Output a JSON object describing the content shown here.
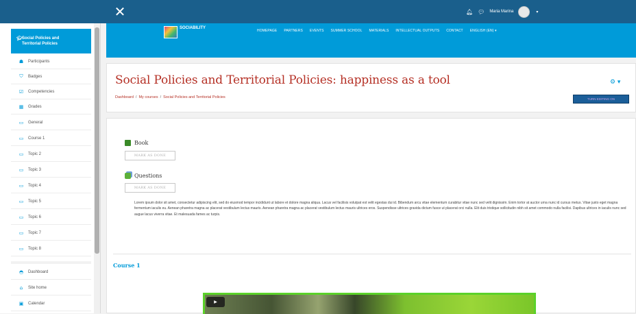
{
  "topbar": {
    "close_glyph": "✕",
    "user_name": "Maria Marina",
    "caret": "▾",
    "bell_icon": "bell-icon",
    "chat_icon": "chat-icon"
  },
  "sidebar": {
    "course_title_line1": "Social Policies and",
    "course_title_line2": "Territorial Policies",
    "items": [
      {
        "label": "Participants",
        "icon": "users-icon",
        "glyph": "☗"
      },
      {
        "label": "Badges",
        "icon": "shield-icon",
        "glyph": "⛉"
      },
      {
        "label": "Competencies",
        "icon": "check-icon",
        "glyph": "☑"
      },
      {
        "label": "Grades",
        "icon": "table-icon",
        "glyph": "▦"
      },
      {
        "label": "General",
        "icon": "folder-icon",
        "glyph": "▭"
      },
      {
        "label": "Course 1",
        "icon": "folder-icon",
        "glyph": "▭"
      },
      {
        "label": "Topic 2",
        "icon": "folder-icon",
        "glyph": "▭"
      },
      {
        "label": "Topic 3",
        "icon": "folder-icon",
        "glyph": "▭"
      },
      {
        "label": "Topic 4",
        "icon": "folder-icon",
        "glyph": "▭"
      },
      {
        "label": "Topic 5",
        "icon": "folder-icon",
        "glyph": "▭"
      },
      {
        "label": "Topic 6",
        "icon": "folder-icon",
        "glyph": "▭"
      },
      {
        "label": "Topic 7",
        "icon": "folder-icon",
        "glyph": "▭"
      },
      {
        "label": "Topic 8",
        "icon": "folder-icon",
        "glyph": "▭"
      },
      {
        "label": "Dashboard",
        "icon": "dashboard-icon",
        "glyph": "◓"
      },
      {
        "label": "Site home",
        "icon": "home-icon",
        "glyph": "⌂"
      },
      {
        "label": "Calendar",
        "icon": "calendar-icon",
        "glyph": "▣"
      }
    ]
  },
  "header": {
    "logo_name": "SOCIABILITY",
    "menu": [
      "HOMEPAGE",
      "PARTNERS",
      "EVENTS",
      "SUMMER SCHOOL",
      "MATERIALS",
      "INTELLECTUAL OUTPUTS",
      "CONTACT",
      "ENGLISH (EN) ▾"
    ]
  },
  "page": {
    "title": "Social Policies and Territorial Policies: happiness as a tool",
    "breadcrumb": [
      "Dashboard",
      "My courses",
      "Social Policies and Territorial Policies"
    ],
    "breadcrumb_sep": "/",
    "gear_glyph": "⚙ ▾",
    "edit_button": "TURN EDITING ON"
  },
  "content": {
    "activities": [
      {
        "name": "Book",
        "button": "MARK AS DONE"
      },
      {
        "name": "Questions",
        "button": "MARK AS DONE"
      }
    ],
    "summary": "Lorem ipsum dolor sit amet, consectetur adipiscing elit, sed do eiusmod tempor incididunt ut labore et dolore magna aliqua. Lacus vel facilisis volutpat est velit egestas dui id. Bibendum arcu vitae elementum curabitur vitae nunc sed velit dignissim. Enim tortor at auctor urna nunc id cursus metus. Vitae justo eget magna fermentum iaculis eu. Aenean pharetra magna ac placerat vestibulum lectus mauris. Aenean pharetra magna ac placerat vestibulum lectus mauris ultrices eros. Suspendisse ultrices gravida dictum fusce ut placerat orci nulla. Elit duis tristique sollicitudin nibh sit amet commodo nulla facilisi. Dapibus ultrices in iaculis nunc sed augue lacus viverra vitae. Et malesuada fames ac turpis.",
    "section_title": "Course 1",
    "video_play": "▶"
  },
  "colors": {
    "topbar": "#1a5f8c",
    "brand": "#009bd9",
    "title_red": "#b53025"
  }
}
